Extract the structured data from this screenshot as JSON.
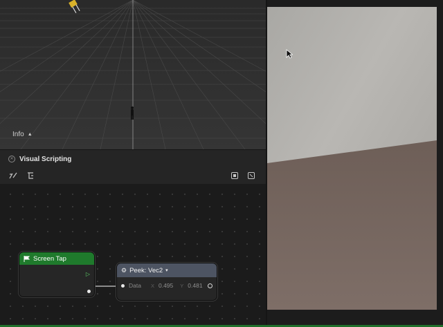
{
  "viewport": {
    "info_label": "Info"
  },
  "visual_scripting": {
    "title": "Visual Scripting",
    "nodes": {
      "screen_tap": {
        "title": "Screen Tap"
      },
      "peek": {
        "title": "Peek: Vec2",
        "data_label": "Data",
        "x_label": "X",
        "x_value": "0.495",
        "y_label": "Y",
        "y_value": "0.481"
      }
    }
  },
  "colors": {
    "event_node_header": "#1f7a2c",
    "peek_node_header": "#4d5462",
    "exec_port": "#5fd66a"
  }
}
